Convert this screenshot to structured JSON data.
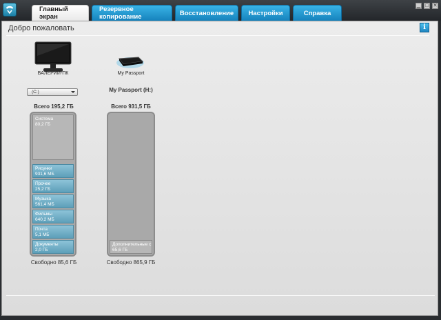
{
  "tabs": [
    {
      "label": "Главный экран",
      "active": true
    },
    {
      "label": "Резервное копирование",
      "active": false
    },
    {
      "label": "Восстановление",
      "active": false
    },
    {
      "label": "Настройки",
      "active": false
    },
    {
      "label": "Справка",
      "active": false
    }
  ],
  "window_buttons": {
    "minimize": "▁",
    "maximize": "□",
    "close": "✕"
  },
  "header": {
    "welcome": "Добро пожаловать",
    "info_icon": "i"
  },
  "devices": {
    "computer": {
      "label": "ВАЛЕРИЙ-ПК",
      "icon": "monitor-icon"
    },
    "passport": {
      "label": "My Passport",
      "icon": "external-drive-icon"
    }
  },
  "left_drive": {
    "selector": "(C:)",
    "total": "Всего 195,2 ГБ",
    "free": "Свободно 85,6 ГБ",
    "segments": [
      {
        "name": "Система",
        "size": "80,2 ГБ"
      },
      {
        "name": "Рисунки",
        "size": "931,6 МБ"
      },
      {
        "name": "Прочее",
        "size": "25,2 ГБ"
      },
      {
        "name": "Музыка",
        "size": "561,4 МБ"
      },
      {
        "name": "Фильмы",
        "size": "640,2 МБ"
      },
      {
        "name": "Почта",
        "size": "5,1 МБ"
      },
      {
        "name": "Документы",
        "size": "2,0 ГБ"
      }
    ]
  },
  "right_drive": {
    "title": "My Passport (H:)",
    "total": "Всего 931,5 ГБ",
    "free": "Свободно 865,9 ГБ",
    "segments": [
      {
        "name": "Дополнительные с",
        "size": "65,6 ГБ"
      }
    ]
  }
}
